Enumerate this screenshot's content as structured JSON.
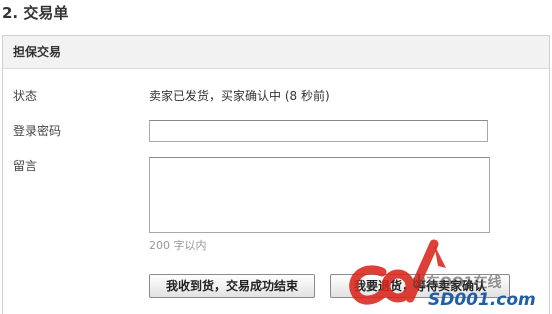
{
  "section_title": "2. 交易单",
  "panel": {
    "header": "担保交易"
  },
  "form": {
    "status_label": "状态",
    "status_value": "卖家已发货，买家确认中 (8 秒前)",
    "password_label": "登录密码",
    "password_value": "",
    "message_label": "留言",
    "message_value": "",
    "message_hint": "200 字以内"
  },
  "buttons": {
    "confirm_label": "我收到货，交易成功结束",
    "refund_label": "我要退货，等待卖家确认"
  },
  "watermark": {
    "logo_text": "cd",
    "site_name": "山东OO1在线",
    "site_url": "SD001.com"
  },
  "colors": {
    "panel_header_bg": "#f2f2f2",
    "border": "#cfcfcf",
    "watermark_red": "#d9261c",
    "watermark_blue": "#1f5fa8"
  }
}
